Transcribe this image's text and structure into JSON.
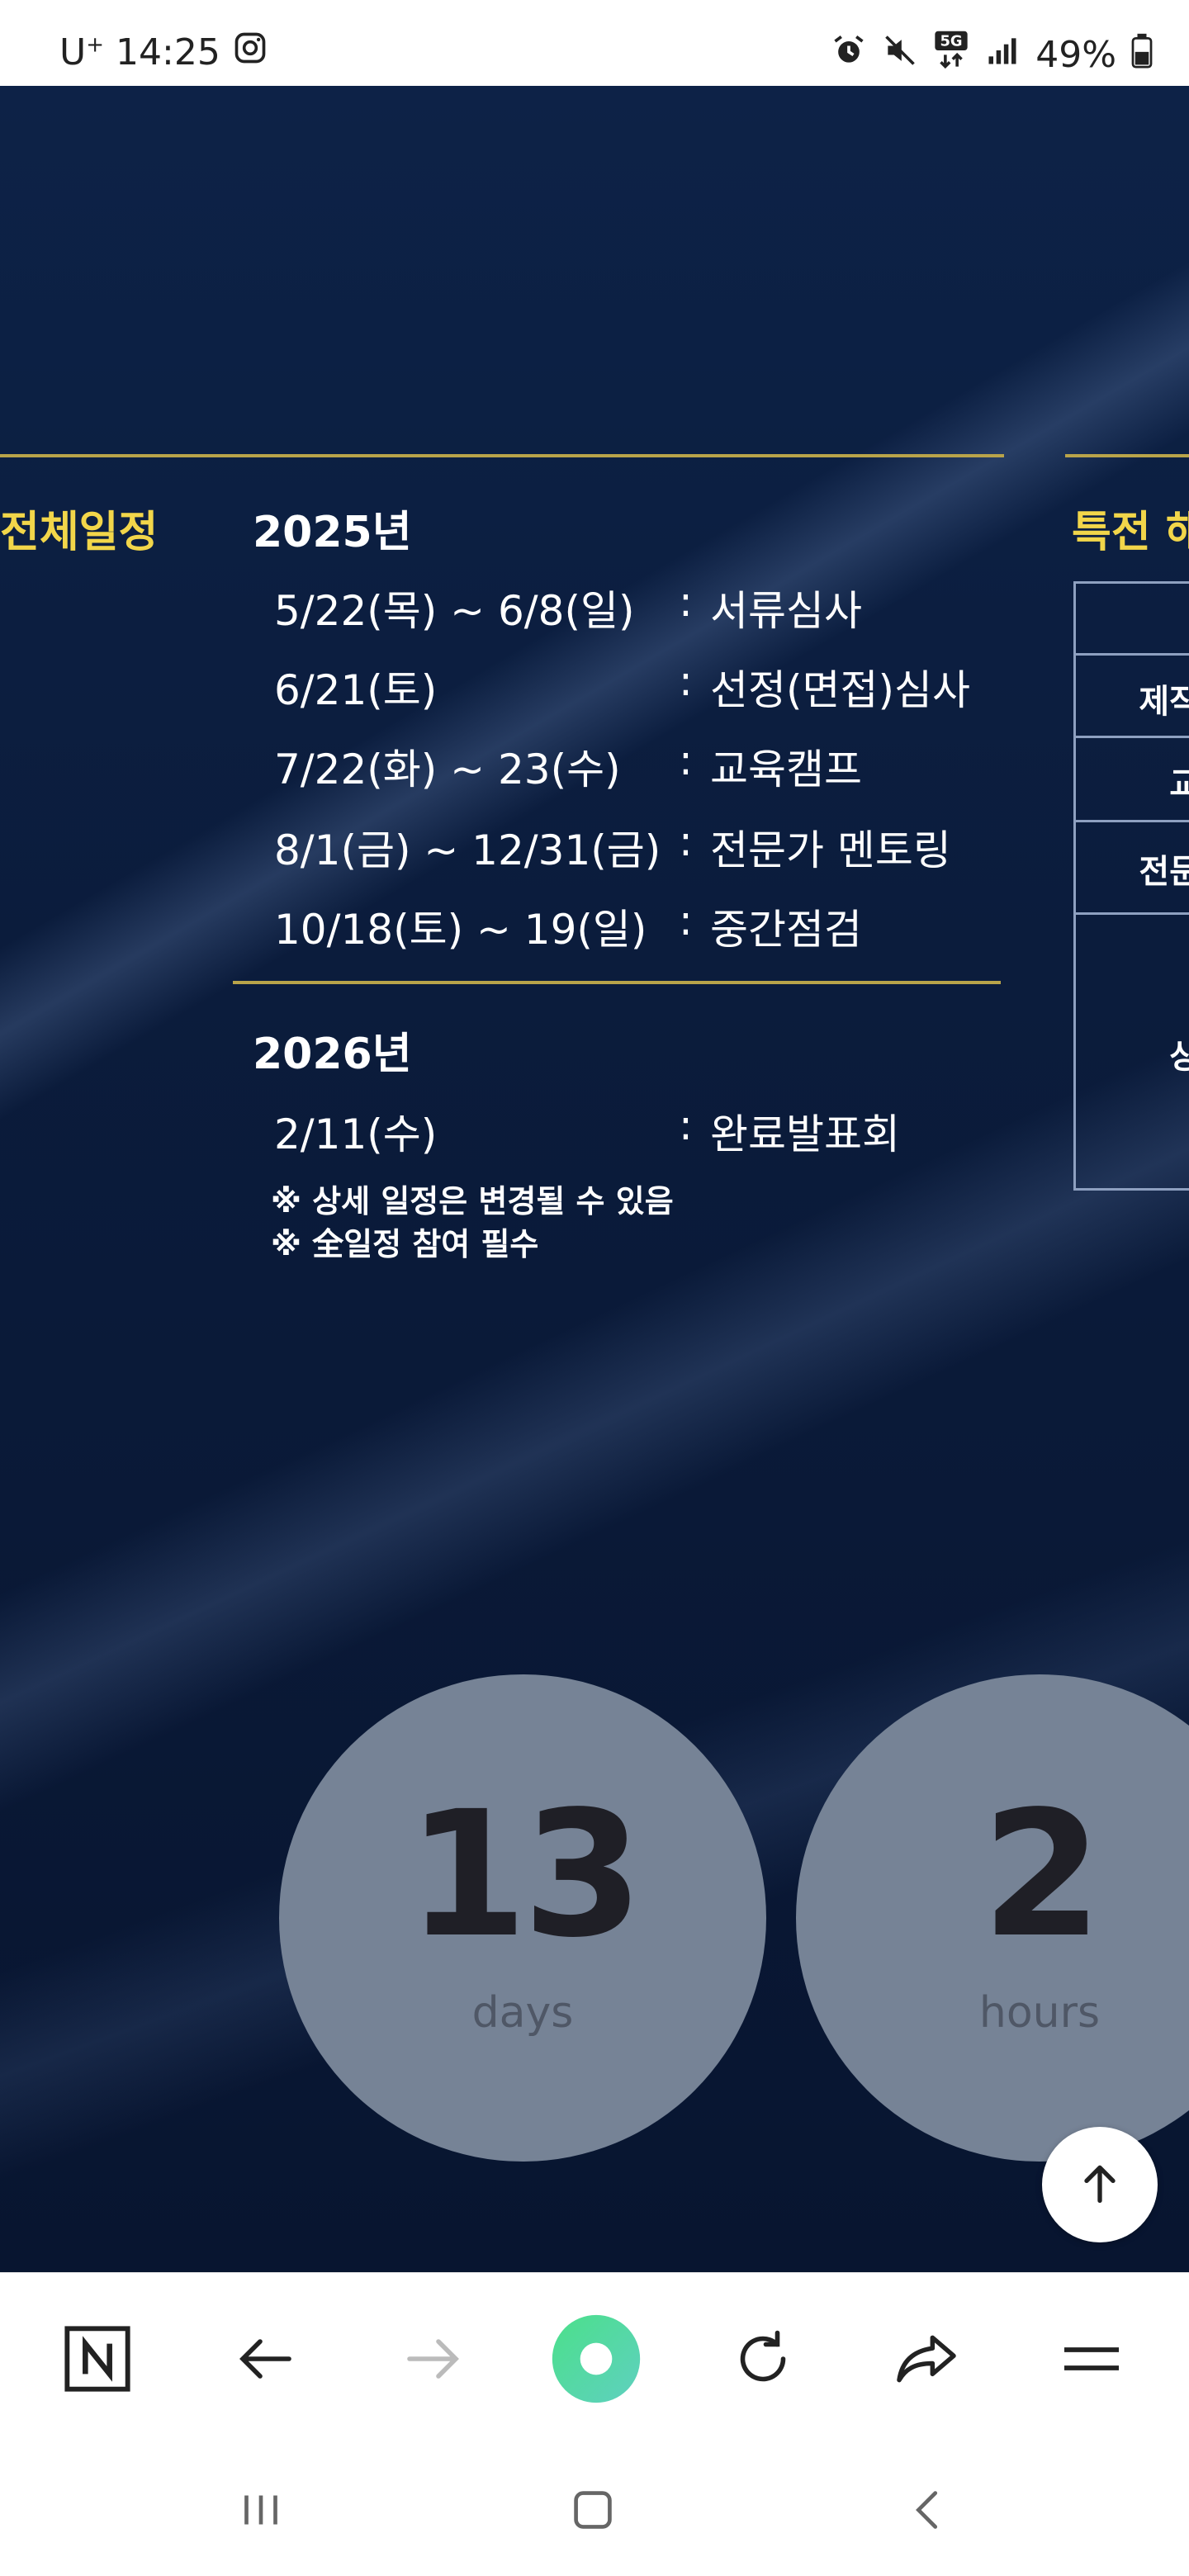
{
  "status_bar": {
    "carrier": "U",
    "carrier_sup": "+",
    "time": "14:25",
    "battery": "49%",
    "icons": [
      "instagram-icon",
      "alarm-icon",
      "mute-icon",
      "5g-icon",
      "signal-icon",
      "battery-icon"
    ]
  },
  "schedule": {
    "section_title": "전체일정",
    "year_2025": "2025년",
    "items_2025": [
      {
        "date": "5/22(목) ~ 6/8(일)",
        "colon": ":",
        "event": "서류심사"
      },
      {
        "date": "6/21(토)",
        "colon": ":",
        "event": "선정(면접)심사"
      },
      {
        "date": "7/22(화) ~ 23(수)",
        "colon": ":",
        "event": "교육캠프"
      },
      {
        "date": "8/1(금) ~ 12/31(금)",
        "colon": ":",
        "event": "전문가 멘토링"
      },
      {
        "date": "10/18(토) ~ 19(일)",
        "colon": ":",
        "event": "중간점검"
      }
    ],
    "year_2026": "2026년",
    "items_2026": [
      {
        "date": "2/11(수)",
        "colon": ":",
        "event": "완료발표회"
      }
    ],
    "notes": [
      "※ 상세 일정은 변경될 수 있음",
      "※ 全일정 참여 필수"
    ]
  },
  "benefits": {
    "title_partial": "특전 해",
    "table_cells": [
      "제작",
      "교",
      "전문",
      "상"
    ]
  },
  "countdown": {
    "days_value": "13",
    "days_label": "days",
    "hours_value": "2",
    "hours_label": "hours"
  },
  "browser_bar": {
    "items": [
      "naver-home-icon",
      "back-arrow-icon",
      "forward-arrow-icon",
      "green-dot-icon",
      "refresh-icon",
      "share-icon",
      "menu-icon"
    ]
  },
  "system_nav": {
    "items": [
      "recent-apps-icon",
      "home-icon",
      "back-icon"
    ]
  },
  "colors": {
    "accent_yellow": "#f2d64a",
    "rule_gold": "#b9a44a",
    "background_navy": "#0b1c3c",
    "circle_gray": "#768396"
  }
}
